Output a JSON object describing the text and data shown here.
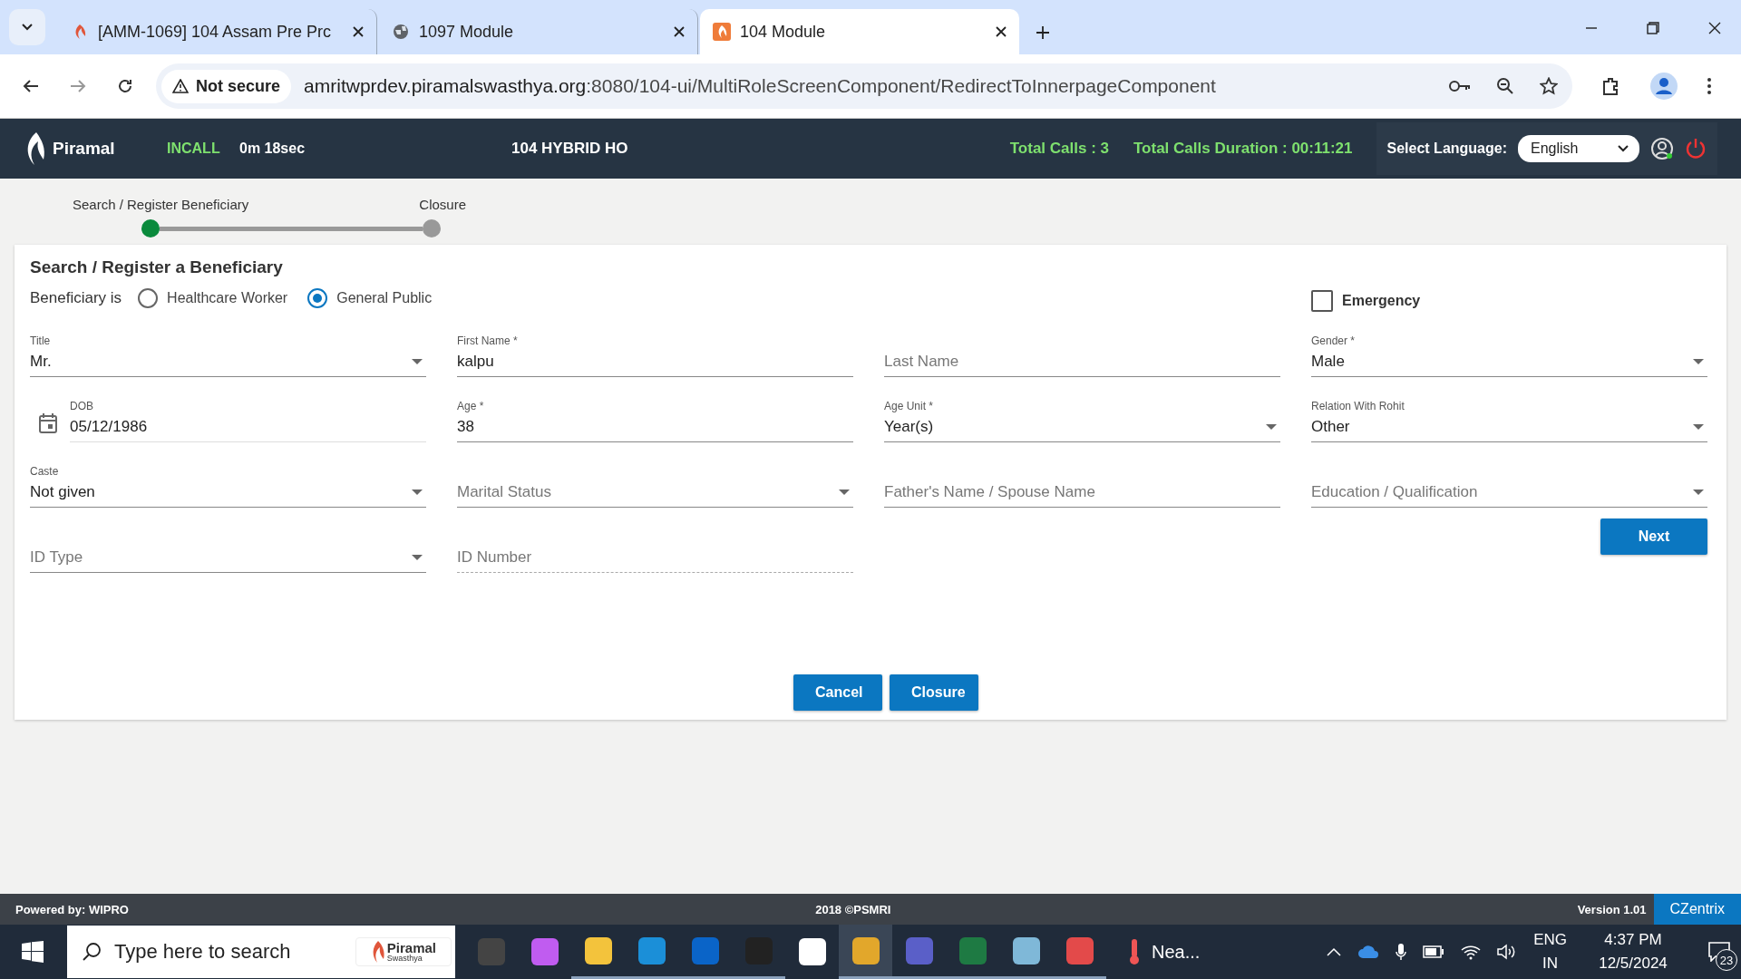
{
  "browser": {
    "tabs": [
      {
        "title": "[AMM-1069] 104 Assam Pre Prc",
        "kind": "piramal",
        "selected": false
      },
      {
        "title": "1097 Module",
        "kind": "globe",
        "selected": false
      },
      {
        "title": "104 Module",
        "kind": "app",
        "selected": true
      }
    ],
    "security": "Not secure",
    "url_host": "amritwprdev.piramalswasthya.org",
    "url_path": ":8080/104-ui/MultiRoleScreenComponent/RedirectToInnerpageComponent"
  },
  "header": {
    "logo": "Piramal",
    "call_status": "INCALL",
    "call_timer": "0m 18sec",
    "center_title": "104 HYBRID HO",
    "total_calls": "Total Calls : 3",
    "total_duration": "Total Calls Duration : 00:11:21",
    "language_label": "Select Language:",
    "language": "English"
  },
  "stepper": {
    "steps": [
      {
        "label": "Search / Register Beneficiary",
        "selected": true
      },
      {
        "label": "Closure",
        "selected": false
      }
    ]
  },
  "form": {
    "title": "Search / Register a Beneficiary",
    "beneficiary_label": "Beneficiary is",
    "beneficiary_types": [
      {
        "label": "Healthcare Worker",
        "selected": false
      },
      {
        "label": "General Public",
        "selected": true
      }
    ],
    "emergency": {
      "label": "Emergency",
      "checked": false
    },
    "fields": [
      {
        "kind": "select",
        "label": "Title",
        "value": "Mr.",
        "disabled": false
      },
      {
        "kind": "text",
        "label": "First Name *",
        "value": "kalpu",
        "disabled": false
      },
      {
        "kind": "text",
        "placeholder": "Last Name",
        "disabled": false
      },
      {
        "kind": "select",
        "label": "Gender *",
        "value": "Male",
        "disabled": false
      },
      {
        "kind": "date",
        "label": "DOB",
        "value": "05/12/1986",
        "disabled": false
      },
      {
        "kind": "text",
        "label": "Age *",
        "value": "38",
        "disabled": false
      },
      {
        "kind": "select",
        "label": "Age Unit *",
        "value": "Year(s)",
        "disabled": false
      },
      {
        "kind": "select",
        "label": "Relation With Rohit",
        "value": "Other",
        "disabled": false
      },
      {
        "kind": "select",
        "label": "Caste",
        "value": "Not given",
        "disabled": false
      },
      {
        "kind": "select",
        "placeholder": "Marital Status",
        "disabled": false
      },
      {
        "kind": "text",
        "placeholder": "Father's Name / Spouse Name",
        "disabled": false
      },
      {
        "kind": "select",
        "placeholder": "Education / Qualification",
        "disabled": false
      },
      {
        "kind": "select",
        "placeholder": "ID Type",
        "disabled": false
      },
      {
        "kind": "text",
        "placeholder": "ID Number",
        "disabled": true
      }
    ],
    "next_button": "Next",
    "actions": [
      "Cancel",
      "Closure"
    ]
  },
  "footer": {
    "powered_by": "Powered by: WIPRO",
    "copyright": "2018 ©PSMRI",
    "version": "Version 1.01",
    "brand": "CZentrix"
  },
  "taskbar": {
    "search_placeholder": "Type here to search",
    "search_logo": "Piramal",
    "search_logo_sub": "Swasthya",
    "weather": "Nea...",
    "language": "ENG",
    "region": "IN",
    "time": "4:37 PM",
    "date": "12/5/2024",
    "notifications": "23"
  }
}
